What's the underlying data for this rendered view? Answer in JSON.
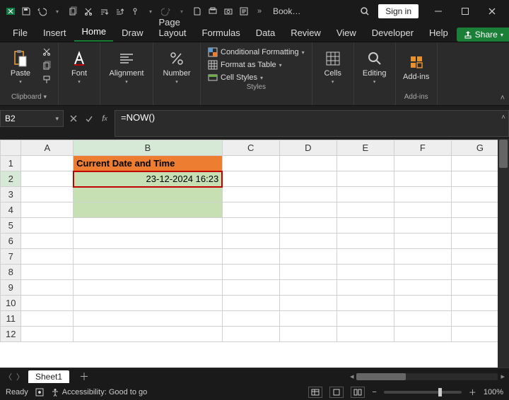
{
  "titlebar": {
    "book_name": "Book…",
    "signin": "Sign in"
  },
  "tabs": {
    "file": "File",
    "insert": "Insert",
    "home": "Home",
    "draw": "Draw",
    "pagelayout": "Page Layout",
    "formulas": "Formulas",
    "data": "Data",
    "review": "Review",
    "view": "View",
    "developer": "Developer",
    "help": "Help",
    "share": "Share"
  },
  "ribbon": {
    "clipboard": {
      "paste": "Paste",
      "label": "Clipboard"
    },
    "font": {
      "btn": "Font"
    },
    "alignment": {
      "btn": "Alignment"
    },
    "number": {
      "btn": "Number"
    },
    "styles": {
      "cond": "Conditional Formatting",
      "table": "Format as Table",
      "cell": "Cell Styles",
      "label": "Styles"
    },
    "cells": {
      "btn": "Cells"
    },
    "editing": {
      "btn": "Editing"
    },
    "addins": {
      "btn": "Add-ins",
      "label": "Add-ins"
    }
  },
  "formula": {
    "namebox": "B2",
    "content": "=NOW()"
  },
  "grid": {
    "cols": [
      "A",
      "B",
      "C",
      "D",
      "E",
      "F",
      "G"
    ],
    "rows": [
      "1",
      "2",
      "3",
      "4",
      "5",
      "6",
      "7",
      "8",
      "9",
      "10",
      "11",
      "12"
    ],
    "b1": "Current Date and Time",
    "b2": "23-12-2024 16:23"
  },
  "sheettabs": {
    "sheet1": "Sheet1"
  },
  "status": {
    "ready": "Ready",
    "access": "Accessibility: Good to go",
    "zoom": "100%"
  },
  "chart_data": {
    "type": "table",
    "title": "Current Date and Time",
    "columns": [
      "Value"
    ],
    "rows": [
      [
        "23-12-2024 16:23"
      ]
    ],
    "formula": "=NOW()",
    "cell": "B2"
  }
}
